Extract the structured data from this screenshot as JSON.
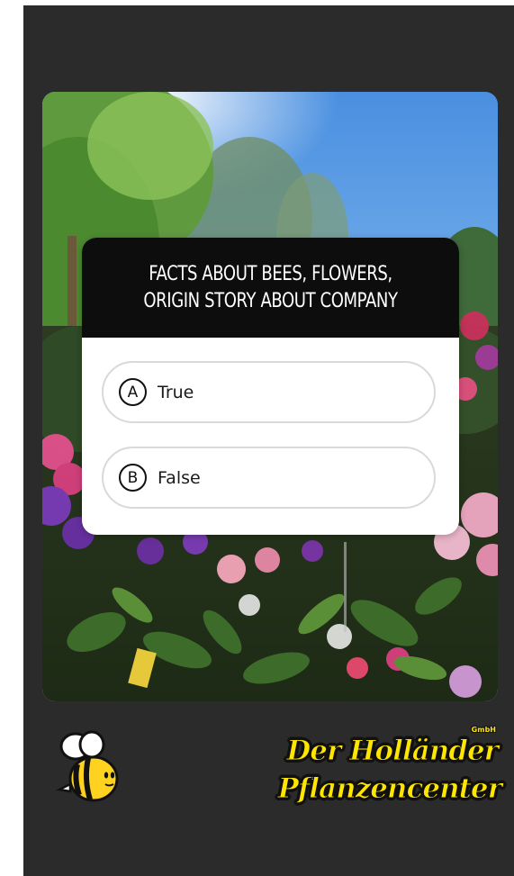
{
  "quiz": {
    "question": "FACTS ABOUT BEES, FLOWERS,\nORIGIN STORY ABOUT COMPANY",
    "options": [
      {
        "letter": "A",
        "label": "True"
      },
      {
        "letter": "B",
        "label": "False"
      }
    ]
  },
  "brand": {
    "line1": "Der Holländer",
    "line2": "Pflanzencenter",
    "suffix": "GmbH"
  },
  "colors": {
    "background": "#2b2b2b",
    "card_header": "#0d0d0d",
    "brand_yellow": "#ffe600"
  },
  "icons": {
    "sticker": "bee-icon"
  }
}
